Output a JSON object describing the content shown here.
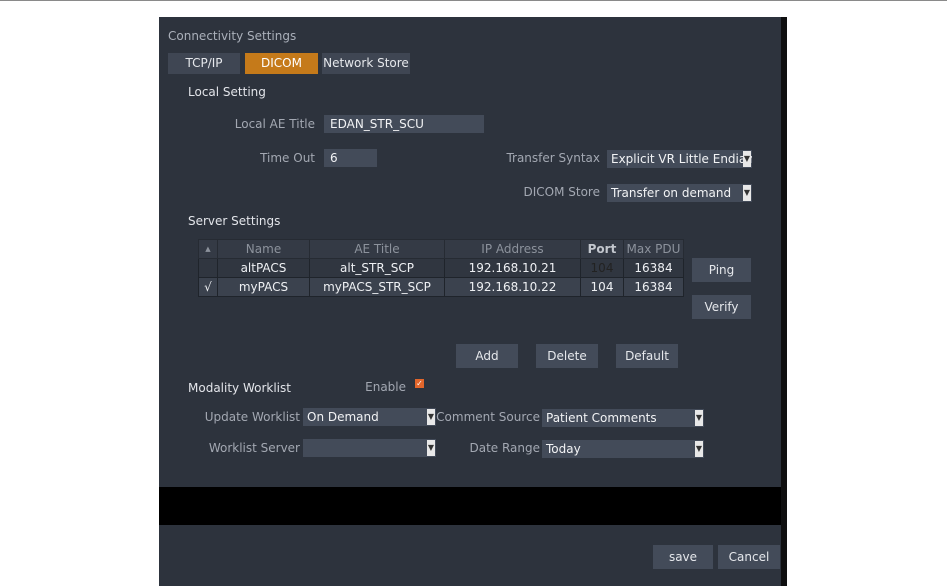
{
  "window_title": "Connectivity Settings",
  "tabs": [
    {
      "label": "TCP/IP",
      "active": false
    },
    {
      "label": "DICOM",
      "active": true
    },
    {
      "label": "Network Store",
      "active": false
    }
  ],
  "local": {
    "section": "Local Setting",
    "ae_title_label": "Local AE Title",
    "ae_title_value": "EDAN_STR_SCU",
    "timeout_label": "Time Out",
    "timeout_value": "6",
    "transfer_syntax_label": "Transfer Syntax",
    "transfer_syntax_value": "Explicit VR Little Endian",
    "dicom_store_label": "DICOM Store",
    "dicom_store_value": "Transfer on demand"
  },
  "server": {
    "section": "Server Settings",
    "sort_indicator": "▲",
    "columns": [
      "Name",
      "AE Title",
      "IP Address",
      "Port",
      "Max PDU"
    ],
    "rows": [
      {
        "check": "",
        "name": "altPACS",
        "ae": "alt_STR_SCP",
        "ip": "192.168.10.21",
        "port": "104",
        "pdu": "16384"
      },
      {
        "check": "√",
        "name": "myPACS",
        "ae": "myPACS_STR_SCP",
        "ip": "192.168.10.22",
        "port": "104",
        "pdu": "16384"
      }
    ],
    "ping": "Ping",
    "verify": "Verify",
    "add": "Add",
    "delete": "Delete",
    "default": "Default"
  },
  "worklist": {
    "section": "Modality Worklist",
    "enable_label": "Enable",
    "enable_checked": true,
    "update_label": "Update Worklist",
    "update_value": "On Demand",
    "comment_label": "Comment Source",
    "comment_value": "Patient Comments",
    "server_label": "Worklist Server",
    "server_value": "",
    "date_label": "Date Range",
    "date_value": "Today"
  },
  "footer": {
    "save": "save",
    "cancel": "Cancel"
  },
  "colors": {
    "panel": "#2d333d",
    "accent": "#c57a1a",
    "field": "#434b59",
    "checkbox": "#e2662b"
  }
}
